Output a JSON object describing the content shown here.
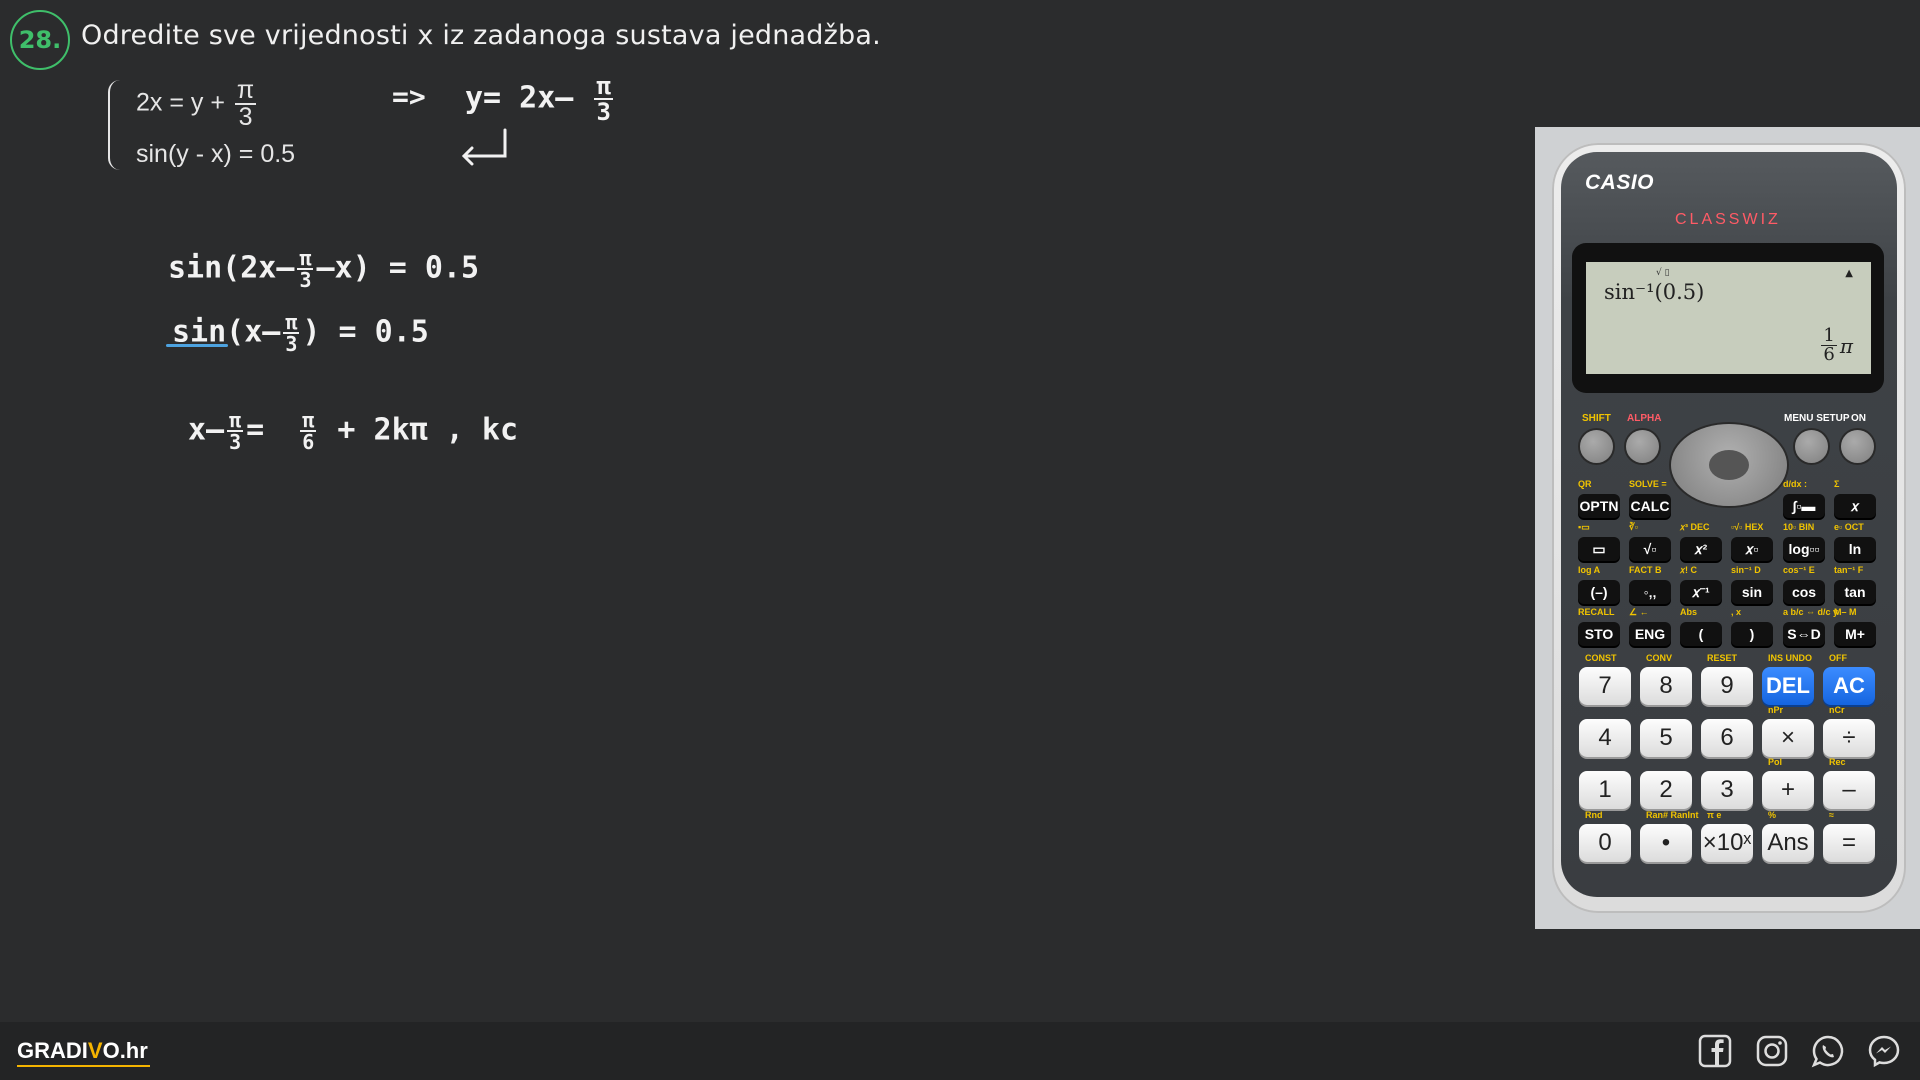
{
  "question": {
    "number": "28.",
    "text": "Odredite sve vrijednosti x iz zadanoga sustava jednadžba."
  },
  "system": {
    "eq1_lhs": "2x = y +",
    "eq1_num": "π",
    "eq1_den": "3",
    "eq2": "sin(y - x) = 0.5",
    "implies": "=>",
    "subst_lhs": "y= 2x–",
    "subst_num": "π",
    "subst_den": "3"
  },
  "work": {
    "line1_a": "sin(2x–",
    "line1_num": "π",
    "line1_den": "3",
    "line1_b": "–x) = 0.5",
    "line2_a": "sin(x–",
    "line2_num": "π",
    "line2_den": "3",
    "line2_b": ") = 0.5",
    "line3_a": "x–",
    "line3_num1": "π",
    "line3_den1": "3",
    "line3_eq": "=",
    "line3_num2": "π",
    "line3_den2": "6",
    "line3_b": "+ 2kπ , kc"
  },
  "calculator": {
    "brand": "CASIO",
    "model": "CLASSWIZ",
    "screen_expr": "sin⁻¹(0.5)",
    "screen_indicator": "√ ▯",
    "screen_arrow": "▲",
    "result_num": "1",
    "result_den": "6",
    "result_suffix": "π",
    "top_labels": {
      "shift": "SHIFT",
      "alpha": "ALPHA",
      "menu_setup": "MENU SETUP",
      "on": "ON"
    },
    "fn_rows": [
      [
        {
          "label": "OPTN",
          "sub": "QR"
        },
        {
          "label": "CALC",
          "sub": "SOLVE ="
        },
        {
          "label": "",
          "sub": ""
        },
        {
          "label": "",
          "sub": ""
        },
        {
          "label": "∫▫▬",
          "sub": "d/dx :"
        },
        {
          "label": "𝑥",
          "sub": "Σ"
        }
      ],
      [
        {
          "label": "▭",
          "sub": "▪▭"
        },
        {
          "label": "√▫",
          "sub": "∛▫"
        },
        {
          "label": "𝑥²",
          "sub": "𝑥³ DEC"
        },
        {
          "label": "𝑥▫",
          "sub": "▫√▫ HEX"
        },
        {
          "label": "log▫▫",
          "sub": "10▫ BIN"
        },
        {
          "label": "ln",
          "sub": "e▫ OCT"
        }
      ],
      [
        {
          "label": "(–)",
          "sub": "log A"
        },
        {
          "label": "◦‚‚",
          "sub": "FACT B"
        },
        {
          "label": "𝑥⁻¹",
          "sub": "𝑥! C"
        },
        {
          "label": "sin",
          "sub": "sin⁻¹ D"
        },
        {
          "label": "cos",
          "sub": "cos⁻¹ E"
        },
        {
          "label": "tan",
          "sub": "tan⁻¹ F"
        }
      ],
      [
        {
          "label": "STO",
          "sub": "RECALL"
        },
        {
          "label": "ENG",
          "sub": "∠ ←"
        },
        {
          "label": "(",
          "sub": "Abs"
        },
        {
          "label": ")",
          "sub": ", x"
        },
        {
          "label": "S⇔D",
          "sub": "a b/c ⇔ d/c y"
        },
        {
          "label": "M+",
          "sub": "M– M"
        }
      ]
    ],
    "num_rows": [
      [
        {
          "label": "7",
          "sub": "CONST"
        },
        {
          "label": "8",
          "sub": "CONV"
        },
        {
          "label": "9",
          "sub": "RESET"
        },
        {
          "label": "DEL",
          "sub": "INS UNDO"
        },
        {
          "label": "AC",
          "sub": "OFF"
        }
      ],
      [
        {
          "label": "4",
          "sub": ""
        },
        {
          "label": "5",
          "sub": ""
        },
        {
          "label": "6",
          "sub": ""
        },
        {
          "label": "×",
          "sub": "nPr"
        },
        {
          "label": "÷",
          "sub": "nCr"
        }
      ],
      [
        {
          "label": "1",
          "sub": ""
        },
        {
          "label": "2",
          "sub": ""
        },
        {
          "label": "3",
          "sub": ""
        },
        {
          "label": "+",
          "sub": "Pol"
        },
        {
          "label": "–",
          "sub": "Rec"
        }
      ],
      [
        {
          "label": "0",
          "sub": "Rnd"
        },
        {
          "label": "•",
          "sub": "Ran# RanInt"
        },
        {
          "label": "×10ˣ",
          "sub": "π e"
        },
        {
          "label": "Ans",
          "sub": "%"
        },
        {
          "label": "=",
          "sub": "≈"
        }
      ]
    ]
  },
  "footer": {
    "logo_a": "GRADI",
    "logo_v": "V",
    "logo_b": "O.hr",
    "icons": [
      "facebook-icon",
      "instagram-icon",
      "whatsapp-icon",
      "messenger-icon"
    ]
  },
  "colors": {
    "background": "#2b2c2d",
    "accent_green": "#3fbf6a",
    "underline_blue": "#4da3e0",
    "calc_red": "#ff5b66",
    "key_blue": "#1565e0",
    "logo_yellow": "#f5b400"
  }
}
